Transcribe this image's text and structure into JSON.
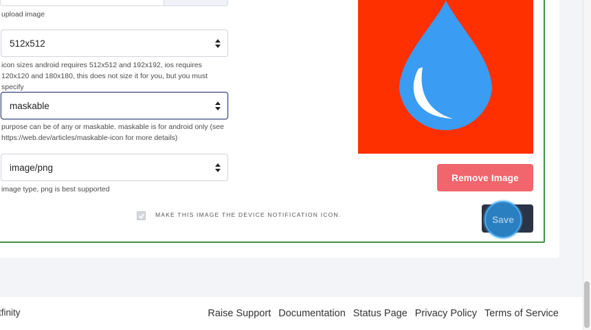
{
  "form": {
    "upload_help": "upload image",
    "size_select": {
      "value": "512x512",
      "help": "icon sizes android requires 512x512 and 192x192, ios requires 120x120 and 180x180, this does not size it for you, but you must specify"
    },
    "purpose_select": {
      "value": "maskable",
      "help": "purpose can be of any or maskable. maskable is for android only (see https://web.dev/articles/maskable-icon for more details)"
    },
    "type_select": {
      "value": "image/png",
      "help": "image type, png is best supported"
    },
    "notification_checkbox": {
      "label": "MAKE THIS IMAGE THE DEVICE NOTIFICATION ICON.",
      "checked": true
    }
  },
  "preview": {
    "background_color": "#ff3000",
    "icon": "water-drop-icon",
    "drop_color": "#3a9cf2"
  },
  "actions": {
    "remove_label": "Remove Image",
    "save_label": "Save"
  },
  "footer": {
    "brand": "tfinity",
    "links": [
      "Raise Support",
      "Documentation",
      "Status Page",
      "Privacy Policy",
      "Terms of Service"
    ]
  },
  "colors": {
    "accent_green": "#3f9142",
    "remove_red": "#f1656c",
    "save_dark": "#2b3346",
    "save_focus": "#2a7fc1"
  }
}
